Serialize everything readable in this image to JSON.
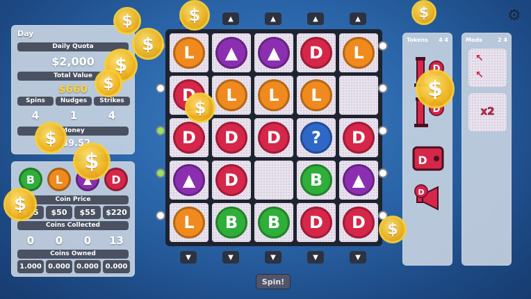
{
  "stats": {
    "day_label": "Day",
    "quota_label": "Daily Quota",
    "quota_value": "$2,000",
    "total_label": "Total Value",
    "total_value": "$660",
    "spins_label": "Spins",
    "nudges_label": "Nudges",
    "strikes_label": "Strikes",
    "spins": "4",
    "nudges": "1",
    "strikes": "4",
    "money_label": "Money",
    "money_value": "$39.52"
  },
  "coins_panel": {
    "price_label": "Coin Price",
    "prices": [
      "$55",
      "$50",
      "$55",
      "$220"
    ],
    "collected_label": "Coins Collected",
    "collected": [
      "0",
      "0",
      "0",
      "13"
    ],
    "owned_label": "Coins Owned",
    "owned": [
      "1.000",
      "0.000",
      "0.000",
      "0.000"
    ],
    "coin_types": [
      {
        "symbol": "B",
        "color": "#2fae3a"
      },
      {
        "symbol": "L",
        "color": "#f08a1e"
      },
      {
        "symbol": "▲",
        "color": "#8b2fb0"
      },
      {
        "symbol": "D",
        "color": "#d6264a"
      }
    ]
  },
  "board": {
    "rows": [
      [
        "L",
        "A",
        "A",
        "D",
        "L"
      ],
      [
        "D",
        "L",
        "L",
        "L",
        ""
      ],
      [
        "D",
        "D",
        "D",
        "?",
        "D"
      ],
      [
        "A",
        "D",
        "",
        "B",
        "A"
      ],
      [
        "L",
        "B",
        "B",
        "D",
        "D"
      ]
    ],
    "symbol_colors": {
      "L": "#f08a1e",
      "A": "#8b2fb0",
      "D": "#d6264a",
      "B": "#2fae3a",
      "?": "#2f67c9"
    },
    "up_arrow": "▲",
    "down_arrow": "▼"
  },
  "tokens": {
    "label": "Tokens",
    "count": "4 4",
    "items": [
      "pump-token",
      "pump-token",
      "wallet-token",
      "megaphone-token"
    ]
  },
  "mods": {
    "label": "Mods",
    "count": "2 4",
    "items": [
      "↖",
      "x2"
    ]
  },
  "spin_label": "Spin!",
  "gold_symbol": "$"
}
